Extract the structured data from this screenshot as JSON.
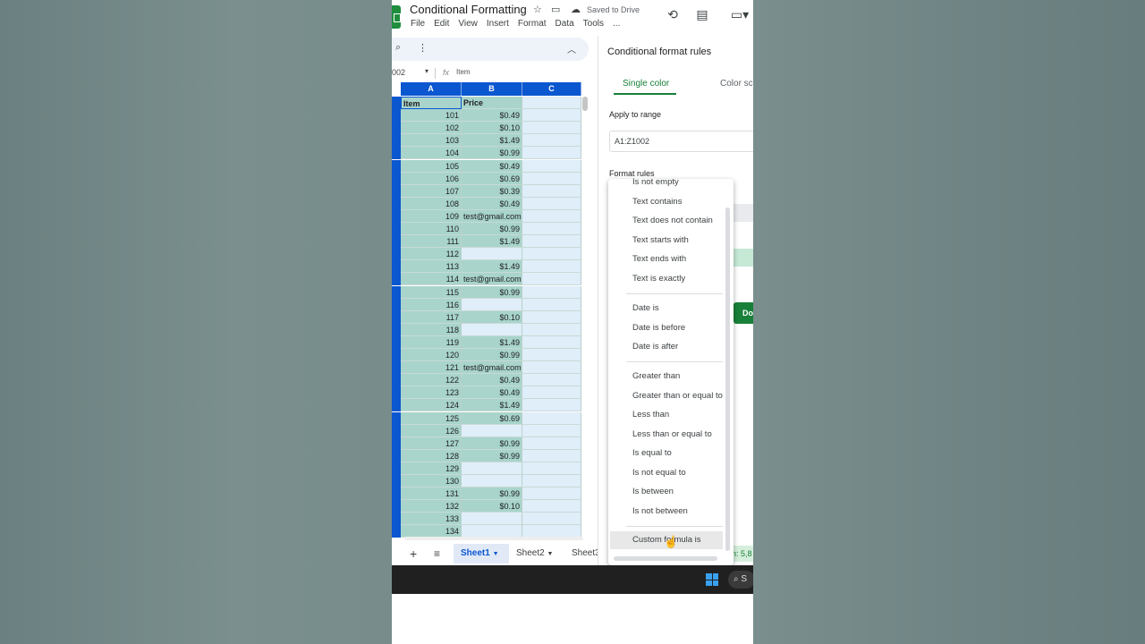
{
  "header": {
    "title": "Conditional Formatting",
    "saved": "Saved to Drive",
    "menu": [
      "File",
      "Edit",
      "View",
      "Insert",
      "Format",
      "Data",
      "Tools",
      "..."
    ]
  },
  "formula_bar": {
    "cell_ref": "002",
    "fx": "fx",
    "value": "Item"
  },
  "columns": [
    "A",
    "B",
    "C"
  ],
  "rows": [
    {
      "a": "Item",
      "b": "Price"
    },
    {
      "a": "101",
      "b": "$0.49"
    },
    {
      "a": "102",
      "b": "$0.10"
    },
    {
      "a": "103",
      "b": "$1.49"
    },
    {
      "a": "104",
      "b": "$0.99"
    },
    {
      "a": "105",
      "b": "$0.49"
    },
    {
      "a": "106",
      "b": "$0.69"
    },
    {
      "a": "107",
      "b": "$0.39"
    },
    {
      "a": "108",
      "b": "$0.49"
    },
    {
      "a": "109",
      "b": "test@gmail.com"
    },
    {
      "a": "110",
      "b": "$0.99"
    },
    {
      "a": "111",
      "b": "$1.49"
    },
    {
      "a": "112",
      "b": ""
    },
    {
      "a": "113",
      "b": "$1.49"
    },
    {
      "a": "114",
      "b": "test@gmail.com"
    },
    {
      "a": "115",
      "b": "$0.99"
    },
    {
      "a": "116",
      "b": ""
    },
    {
      "a": "117",
      "b": "$0.10"
    },
    {
      "a": "118",
      "b": ""
    },
    {
      "a": "119",
      "b": "$1.49"
    },
    {
      "a": "120",
      "b": "$0.99"
    },
    {
      "a": "121",
      "b": "test@gmail.com"
    },
    {
      "a": "122",
      "b": "$0.49"
    },
    {
      "a": "123",
      "b": "$0.49"
    },
    {
      "a": "124",
      "b": "$1.49"
    },
    {
      "a": "125",
      "b": "$0.69"
    },
    {
      "a": "126",
      "b": ""
    },
    {
      "a": "127",
      "b": "$0.99"
    },
    {
      "a": "128",
      "b": "$0.99"
    },
    {
      "a": "129",
      "b": ""
    },
    {
      "a": "130",
      "b": ""
    },
    {
      "a": "131",
      "b": "$0.99"
    },
    {
      "a": "132",
      "b": "$0.10"
    },
    {
      "a": "133",
      "b": ""
    },
    {
      "a": "134",
      "b": ""
    }
  ],
  "sheet_tabs": {
    "add": "+",
    "list": "≡",
    "tabs": [
      "Sheet1",
      "Sheet2",
      "Sheet3"
    ],
    "active": "Sheet1"
  },
  "panel": {
    "title": "Conditional format rules",
    "tab_single": "Single color",
    "tab_scale": "Color sc",
    "apply_label": "Apply to range",
    "range_value": "A1:Z1002",
    "format_rules_label": "Format rules",
    "done": "Do",
    "status": "n: 5,8"
  },
  "dropdown": {
    "group1": [
      "Is not empty",
      "Text contains",
      "Text does not contain",
      "Text starts with",
      "Text ends with",
      "Text is exactly"
    ],
    "group2": [
      "Date is",
      "Date is before",
      "Date is after"
    ],
    "group3": [
      "Greater than",
      "Greater than or equal to",
      "Less than",
      "Less than or equal to",
      "Is equal to",
      "Is not equal to",
      "Is between",
      "Is not between"
    ],
    "group4": [
      "Custom formula is"
    ],
    "highlighted": "Custom formula is"
  },
  "taskbar": {
    "search": "S"
  },
  "colors": {
    "accent_green": "#188038",
    "blue_header": "#0b57d0",
    "teal_fill": "#a8d4cb"
  }
}
